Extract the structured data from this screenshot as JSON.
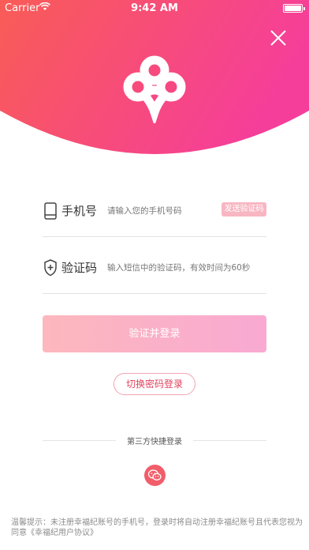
{
  "status_bar": {
    "carrier": "Carrier",
    "time": "9:42 AM"
  },
  "colors": {
    "gradient_start": "#f95c56",
    "gradient_end": "#f53e9a",
    "accent": "#e0435e"
  },
  "icons": {
    "close": "close-icon",
    "logo": "clover-knot-logo",
    "phone": "phone-icon",
    "shield": "shield-plus-icon",
    "wechat": "wechat-icon"
  },
  "phone_field": {
    "label": "手机号",
    "placeholder": "请输入您的手机号码",
    "value": "",
    "send_code_label": "发送验证码"
  },
  "code_field": {
    "label": "验证码",
    "placeholder": "输入短信中的验证码，有效时间为60秒",
    "value": ""
  },
  "login_button": "验证并登录",
  "switch_button": "切换密码登录",
  "third_party": {
    "title": "第三方快捷登录"
  },
  "notice": "温馨提示：未注册幸福纪账号的手机号，登录时将自动注册幸福纪账号且代表您视为同意《幸福纪用户协议》"
}
